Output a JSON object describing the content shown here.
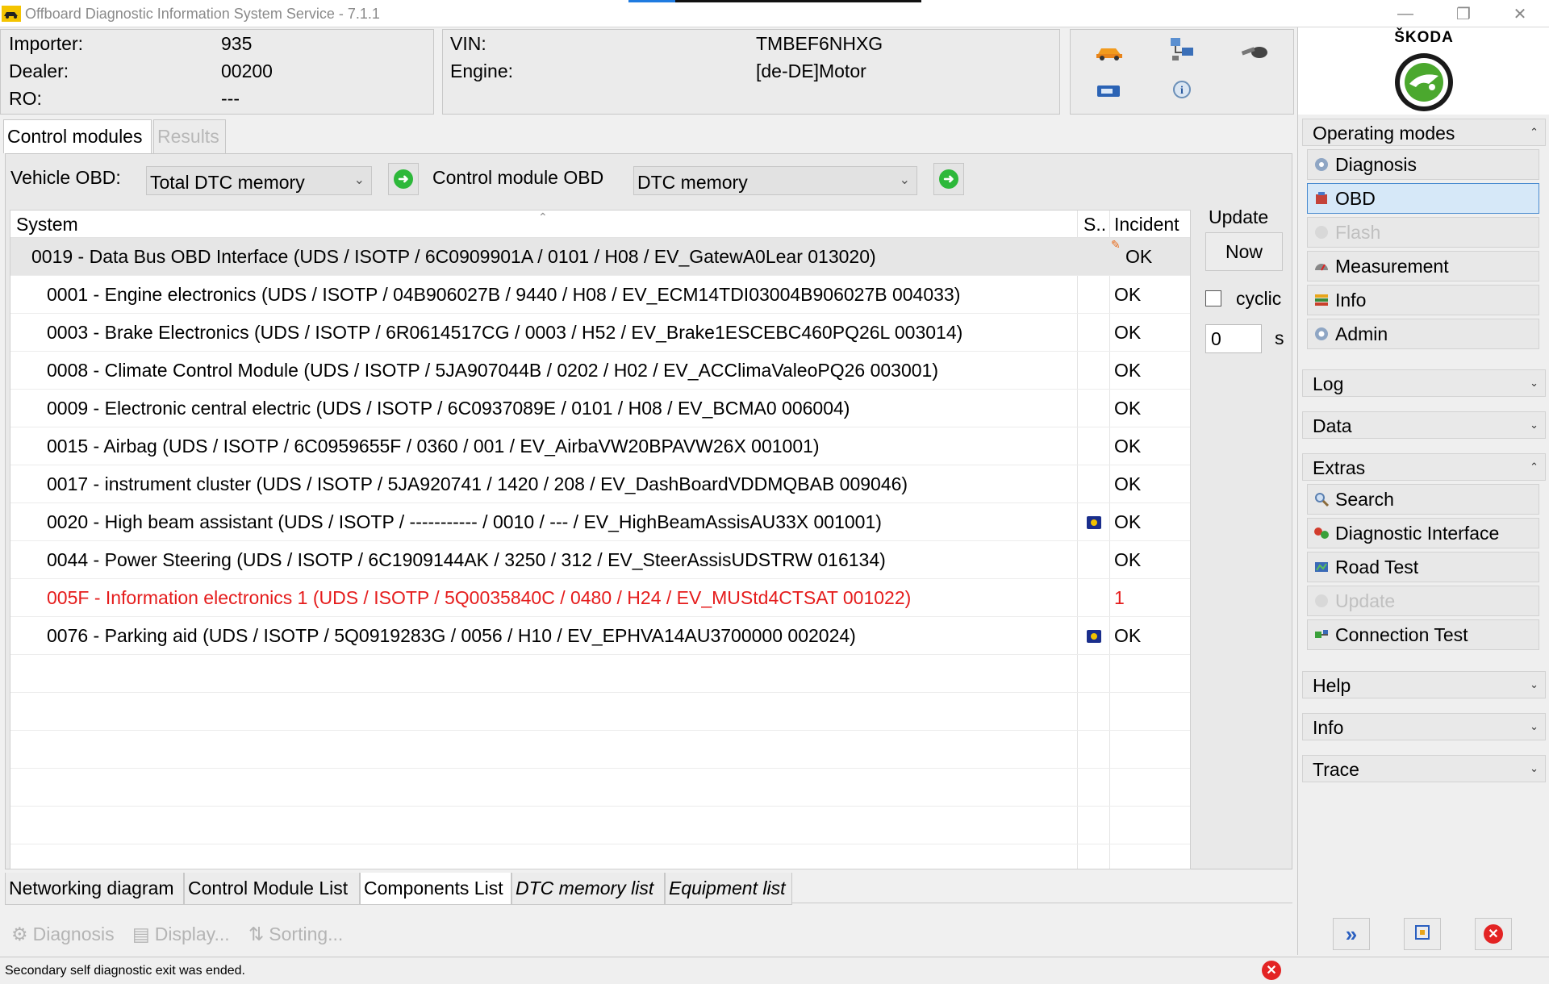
{
  "window": {
    "title": "Offboard Diagnostic Information System Service - 7.1.1",
    "progress_fraction": 0.16
  },
  "header": {
    "importer_label": "Importer:",
    "importer_value": "935",
    "dealer_label": "Dealer:",
    "dealer_value": "00200",
    "ro_label": "RO:",
    "ro_value": "---",
    "vin_label": "VIN:",
    "vin_value": "TMBEF6NHXG",
    "engine_label": "Engine:",
    "engine_value": "[de-DE]Motor",
    "brand": "ŠKODA"
  },
  "top_tabs": [
    "Control modules",
    "Results"
  ],
  "filters": {
    "vehicle_obd_label": "Vehicle OBD:",
    "vehicle_obd_value": "Total DTC memory",
    "module_obd_label": "Control module OBD",
    "module_obd_value": "DTC memory"
  },
  "table": {
    "headers": {
      "system": "System",
      "status": "S..",
      "incident": "Incident"
    },
    "rows": [
      {
        "text": "0019 - Data Bus OBD Interface  (UDS / ISOTP / 6C0909901A / 0101 / H08 / EV_GatewA0Lear 013020)",
        "incident": "OK",
        "selected": true,
        "flag": false,
        "fault": false
      },
      {
        "text": "0001 - Engine electronics  (UDS / ISOTP / 04B906027B / 9440 / H08 / EV_ECM14TDI03004B906027B 004033)",
        "incident": "OK",
        "selected": false,
        "flag": false,
        "fault": false
      },
      {
        "text": "0003 - Brake Electronics  (UDS / ISOTP / 6R0614517CG / 0003 / H52 / EV_Brake1ESCEBC460PQ26L 003014)",
        "incident": "OK",
        "selected": false,
        "flag": false,
        "fault": false
      },
      {
        "text": "0008 - Climate Control Module  (UDS / ISOTP / 5JA907044B / 0202 / H02 / EV_ACClimaValeoPQ26 003001)",
        "incident": "OK",
        "selected": false,
        "flag": false,
        "fault": false
      },
      {
        "text": "0009 - Electronic central electric  (UDS / ISOTP / 6C0937089E / 0101 / H08 / EV_BCMA0 006004)",
        "incident": "OK",
        "selected": false,
        "flag": false,
        "fault": false
      },
      {
        "text": "0015 - Airbag  (UDS / ISOTP / 6C0959655F / 0360 / 001 / EV_AirbaVW20BPAVW26X 001001)",
        "incident": "OK",
        "selected": false,
        "flag": false,
        "fault": false
      },
      {
        "text": "0017 - instrument cluster  (UDS / ISOTP / 5JA920741 / 1420 / 208 / EV_DashBoardVDDMQBAB 009046)",
        "incident": "OK",
        "selected": false,
        "flag": false,
        "fault": false
      },
      {
        "text": "0020 - High beam assistant  (UDS / ISOTP / ----------- / 0010 / --- / EV_HighBeamAssisAU33X 001001)",
        "incident": "OK",
        "selected": false,
        "flag": true,
        "fault": false
      },
      {
        "text": "0044 - Power Steering  (UDS / ISOTP / 6C1909144AK / 3250 / 312 / EV_SteerAssisUDSTRW 016134)",
        "incident": "OK",
        "selected": false,
        "flag": false,
        "fault": false
      },
      {
        "text": "005F - Information electronics 1  (UDS / ISOTP / 5Q0035840C / 0480 / H24 / EV_MUStd4CTSAT 001022)",
        "incident": "1",
        "selected": false,
        "flag": false,
        "fault": true
      },
      {
        "text": "0076 - Parking aid  (UDS / ISOTP / 5Q0919283G / 0056 / H10 / EV_EPHVA14AU3700000 002024)",
        "incident": "OK",
        "selected": false,
        "flag": true,
        "fault": false
      }
    ]
  },
  "update": {
    "label": "Update",
    "now_label": "Now",
    "cyclic_label": "cyclic",
    "cyclic_checked": false,
    "interval_value": "0",
    "unit": "s"
  },
  "bottom_tabs": [
    "Networking diagram",
    "Control Module List",
    "Components List",
    "DTC memory list",
    "Equipment list"
  ],
  "actions": [
    "Diagnosis",
    "Display...",
    "Sorting..."
  ],
  "status": {
    "message": "Secondary self diagnostic exit was ended."
  },
  "sidebar": {
    "operating_modes": "Operating modes",
    "modes": [
      "Diagnosis",
      "OBD",
      "Flash",
      "Measurement",
      "Info",
      "Admin"
    ],
    "log": "Log",
    "data": "Data",
    "extras": "Extras",
    "extras_items": [
      "Search",
      "Diagnostic Interface",
      "Road Test",
      "Update",
      "Connection Test"
    ],
    "help": "Help",
    "info": "Info",
    "trace": "Trace"
  },
  "colors": {
    "accent": "#1f7be0",
    "fault": "#e51c1c",
    "selected_nav": "#d6e8f8",
    "skoda_green": "#4ba82e"
  }
}
